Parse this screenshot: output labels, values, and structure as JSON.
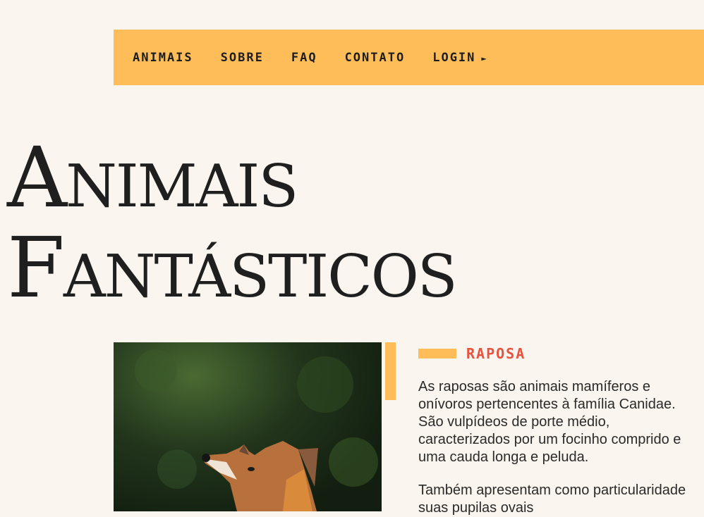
{
  "nav": {
    "items": [
      {
        "label": "ANIMAIS"
      },
      {
        "label": "SOBRE"
      },
      {
        "label": "FAQ"
      },
      {
        "label": "CONTATO"
      },
      {
        "label": "LOGIN",
        "icon": "play-arrow-icon",
        "glyph": "►"
      }
    ]
  },
  "hero": {
    "line1": "Animais",
    "line2": "Fantásticos"
  },
  "animal": {
    "title": "RAPOSA",
    "paragraphs": [
      "As raposas são animais mamíferos e onívoros pertencentes à família Canidae. São vulpídeos de porte médio, caracterizados por um focinho comprido e uma cauda longa e peluda.",
      "Também apresentam como particularidade suas pupilas ovais"
    ]
  },
  "colors": {
    "background": "#faf5ee",
    "accent": "#ffbd59",
    "heading_red": "#e8533f",
    "text": "#222222"
  }
}
